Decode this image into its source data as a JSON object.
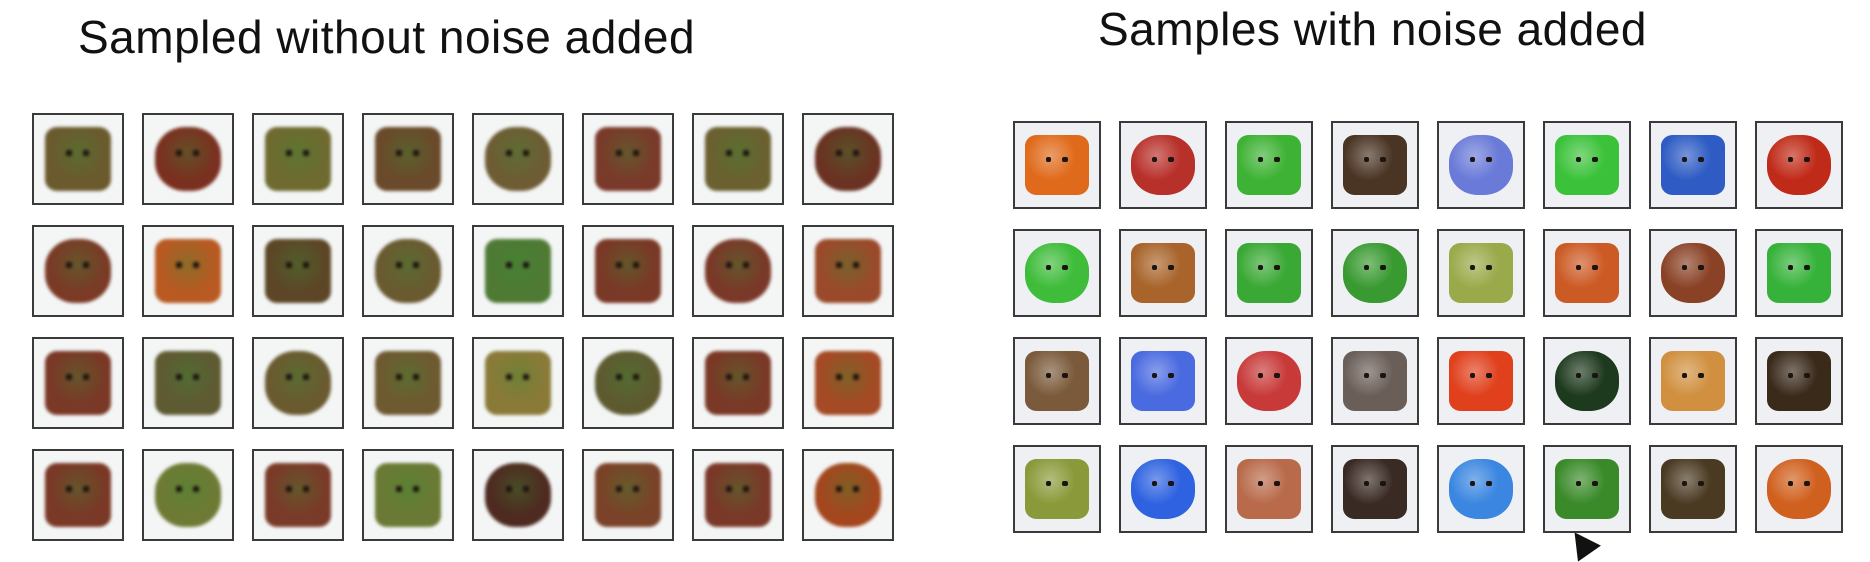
{
  "left_panel": {
    "title": "Sampled without noise added",
    "tiles": [
      [
        "#6b5a2e",
        "#7a3020",
        "#6e6a30",
        "#6a4a2a",
        "#6e5c34",
        "#7a3a2a",
        "#6a6030",
        "#6a3222"
      ],
      [
        "#7a3a26",
        "#b85a22",
        "#5c4626",
        "#6a5a30",
        "#4e7a34",
        "#7a3826",
        "#7a3828",
        "#9a4a2a"
      ],
      [
        "#7a3826",
        "#5e5a32",
        "#6a5a30",
        "#6e5a30",
        "#8a7a38",
        "#5e5a30",
        "#7a3826",
        "#a44a24"
      ],
      [
        "#7a3826",
        "#6e7a34",
        "#7a3a28",
        "#6a7a34",
        "#4e2a20",
        "#7a4228",
        "#7a3828",
        "#a4461e"
      ]
    ]
  },
  "right_panel": {
    "title": "Samples with noise added",
    "tiles": [
      [
        "#e06a1c",
        "#b8302a",
        "#3eb234",
        "#4a3424",
        "#6a7ad8",
        "#3cc23a",
        "#2e5cc4",
        "#c02a18"
      ],
      [
        "#3ebc3a",
        "#a8642a",
        "#3aa834",
        "#3a9a32",
        "#9aaa4a",
        "#cc5a24",
        "#8a4226",
        "#36b23a"
      ],
      [
        "#7a5a3a",
        "#4a6ae0",
        "#c83a3a",
        "#6a5e58",
        "#e0401c",
        "#1e3a1e",
        "#d09040",
        "#3a2a1a"
      ],
      [
        "#8a9a3a",
        "#2e62e0",
        "#b86a4a",
        "#3a2a24",
        "#3a86e0",
        "#3a8a2a",
        "#4a3a22",
        "#d0601e"
      ]
    ]
  }
}
